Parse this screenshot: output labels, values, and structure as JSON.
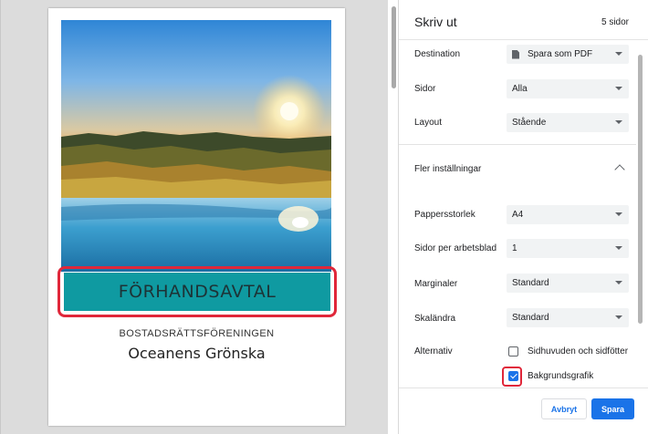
{
  "preview": {
    "document": {
      "title": "FÖRHANDSAVTAL",
      "subtitle": "BOSTADSRÄTTSFÖRENINGEN",
      "name": "Oceanens Grönska"
    }
  },
  "panel": {
    "title": "Skriv ut",
    "page_count": "5 sidor",
    "destination": {
      "label": "Destination",
      "value": "Spara som PDF",
      "icon": "file-icon"
    },
    "pages": {
      "label": "Sidor",
      "value": "Alla"
    },
    "layout": {
      "label": "Layout",
      "value": "Stående"
    },
    "more_settings": {
      "label": "Fler inställningar",
      "icon": "chevron-up-icon"
    },
    "paper_size": {
      "label": "Pappersstorlek",
      "value": "A4"
    },
    "pages_per_sheet": {
      "label": "Sidor per arbetsblad",
      "value": "1"
    },
    "margins": {
      "label": "Marginaler",
      "value": "Standard"
    },
    "scale": {
      "label": "Skaländra",
      "value": "Standard"
    },
    "options": {
      "label": "Alternativ",
      "headers_footers": {
        "label": "Sidhuvuden och sidfötter",
        "checked": false
      },
      "background_graphics": {
        "label": "Bakgrundsgrafik",
        "checked": true
      }
    },
    "cancel_label": "Avbryt",
    "save_label": "Spara"
  },
  "colors": {
    "accent": "#1a73e8",
    "title_bar": "#0f9aa1",
    "highlight": "#e0273a"
  }
}
